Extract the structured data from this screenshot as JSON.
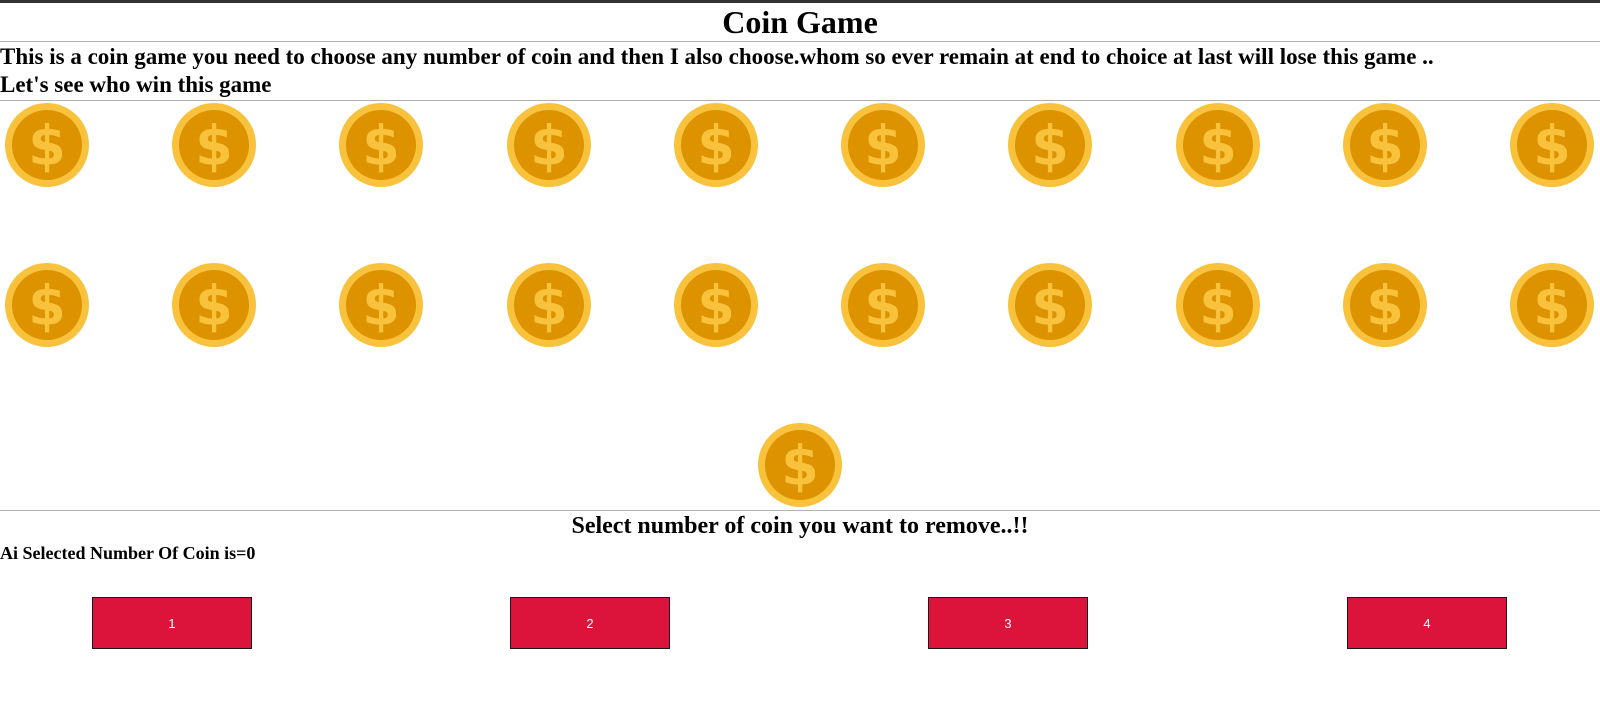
{
  "game": {
    "title": "Coin Game",
    "intro_line1": "This is a coin game you need to choose any number of coin and then I also choose.whom so ever remain at end to choice at last will lose this game ..",
    "intro_line2": "Let's see who win this game",
    "prompt": "Select number of coin you want to remove..!!",
    "ai_status": "Ai Selected Number Of Coin is=0",
    "coins_remaining": 21,
    "coin_icon": "dollar-coin-icon",
    "colors": {
      "coin_outer": "#f9c23c",
      "coin_inner": "#dd9200",
      "coin_symbol": "#f9c23c",
      "button_bg": "#dc143c",
      "button_text": "#ffffff"
    }
  },
  "buttons": [
    {
      "label": "1"
    },
    {
      "label": "2"
    },
    {
      "label": "3"
    },
    {
      "label": "4"
    }
  ]
}
